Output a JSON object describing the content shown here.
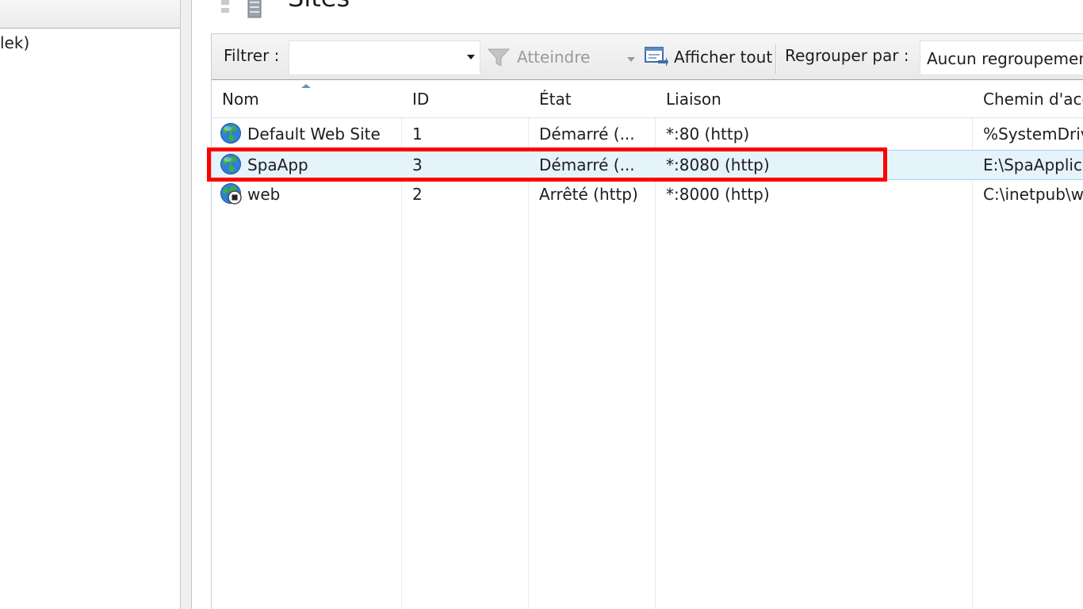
{
  "tree": {
    "partial_item": "lek)"
  },
  "page": {
    "title": "Sites"
  },
  "toolbar": {
    "filter_label": "Filtrer :",
    "filter_value": "",
    "goto_label": "Atteindre",
    "show_all_label": "Afficher tout",
    "group_by_label": "Regrouper par :",
    "group_by_value": "Aucun regroupement"
  },
  "grid": {
    "columns": [
      "Nom",
      "ID",
      "État",
      "Liaison",
      "Chemin d'accès"
    ],
    "rows": [
      {
        "name": "Default Web Site",
        "id": "1",
        "state": "Démarré (...",
        "binding": "*:80 (http)",
        "path": "%SystemDrive%\\inetpub\\wwwroot",
        "icon": "globe-icon"
      },
      {
        "name": "SpaApp",
        "id": "3",
        "state": "Démarré (...",
        "binding": "*:8080 (http)",
        "path": "E:\\SpaApplication",
        "icon": "globe-icon"
      },
      {
        "name": "web",
        "id": "2",
        "state": "Arrêté (http)",
        "binding": "*:8000 (http)",
        "path": "C:\\inetpub\\web",
        "icon": "globe-stopped-icon"
      }
    ],
    "selected_row": 1
  },
  "colors": {
    "highlight": "#ff0000",
    "selection": "#e5f3fb",
    "selection_border": "#a5d4f0"
  }
}
